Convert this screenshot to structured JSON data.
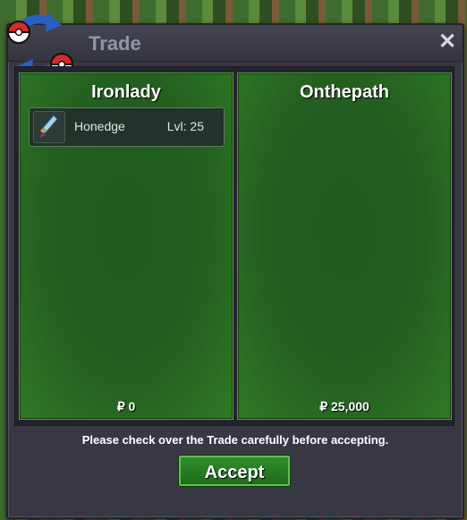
{
  "window": {
    "title": "Trade",
    "close_label": "✕"
  },
  "trade": {
    "left": {
      "name": "Ironlady",
      "items": [
        {
          "name": "Honedge",
          "level": "Lvl: 25",
          "icon": "honedge-sword-icon"
        }
      ],
      "money": "₽ 0"
    },
    "right": {
      "name": "Onthepath",
      "items": [],
      "money": "₽ 25,000"
    }
  },
  "notice": "Please check over the Trade carefully before accepting.",
  "accept_label": "Accept",
  "colors": {
    "panel_green": "#245f20",
    "panel_border": "#4ea43e",
    "window_bg": "#383843",
    "accept_green": "#2f8f2a"
  }
}
